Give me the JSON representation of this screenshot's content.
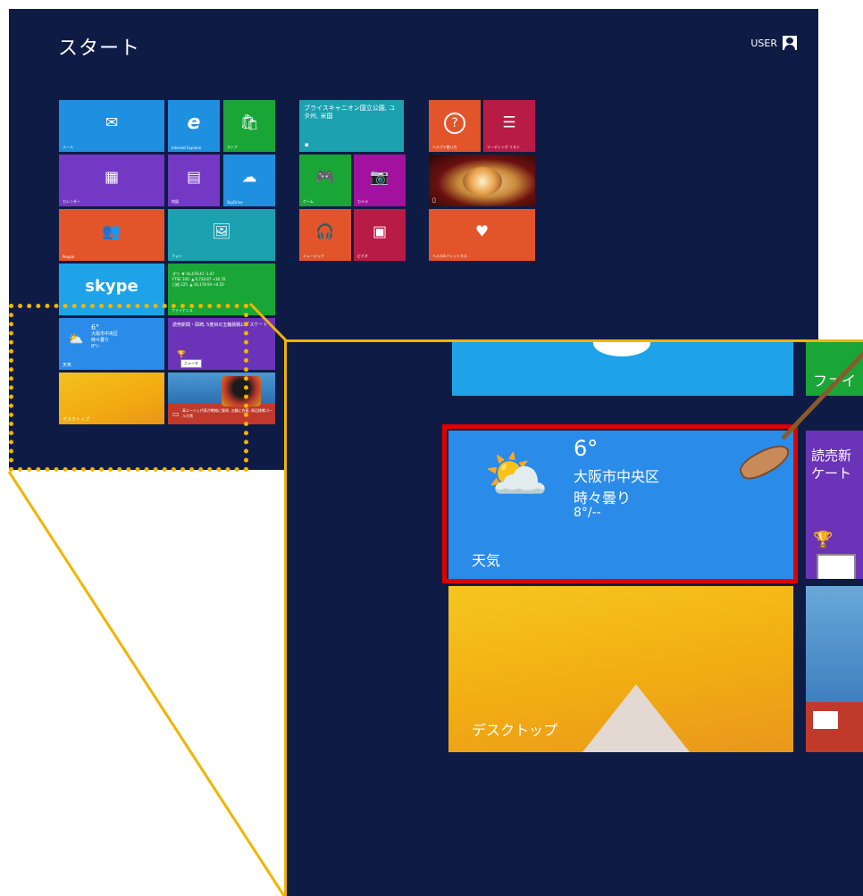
{
  "start": {
    "title": "スタート",
    "user": "USER"
  },
  "tiles": {
    "mail": "メール",
    "ie": "Internet Explorer",
    "store": "ストア",
    "travel_text": "ブライスキャニオン国立公園, ユタ州, 米国",
    "help": "ヘルプ+使い方",
    "reading": "リーディング リスト",
    "calendar": "カレンダー",
    "maps": "地図",
    "skydrive": "SkyDrive",
    "games": "ゲーム",
    "camera": "カメラ",
    "people": "People",
    "photos": "フォト",
    "music": "ミュージック",
    "video": "ビデオ",
    "health": "ヘルス&フィットネス",
    "skype": "skype",
    "finance": {
      "label": "ファイナンス",
      "rows": [
        {
          "name": "ダウ",
          "value": "▼ 16,478.41 -1.47"
        },
        {
          "name": "FTSE 100",
          "value": "▲ 6,730.87 +36.70"
        },
        {
          "name": "日経 225",
          "value": "▲ 16,178.94 +4.50"
        }
      ]
    },
    "weather": {
      "temp": "6°",
      "city": "大阪市中央区",
      "condition": "時々曇り",
      "range": "8°/--",
      "label": "天気"
    },
    "news_text": "読売新聞・岡崎, 5度目の五輪挑戦に「スケート",
    "news_label": "ニュース",
    "news_headline": "高エージェ代表が戦線に復帰, 五輪に合意, 周辺挑戦ゴール大賞",
    "desktop": "デスクトップ"
  },
  "zoom": {
    "finance_partial": "ファイ",
    "weather": {
      "temp": "6°",
      "city": "大阪市中央区",
      "condition": "時々曇り",
      "range": "8°/--",
      "label": "天気"
    },
    "news_partial": "読売新ケート",
    "news_partial_line1": "読売新",
    "news_partial_line2": "ケート",
    "desktop": "デスクトップ"
  },
  "colors": {
    "background": "#0e1c45",
    "highlight_frame": "#e00000",
    "zoom_frame": "#f2b400"
  }
}
